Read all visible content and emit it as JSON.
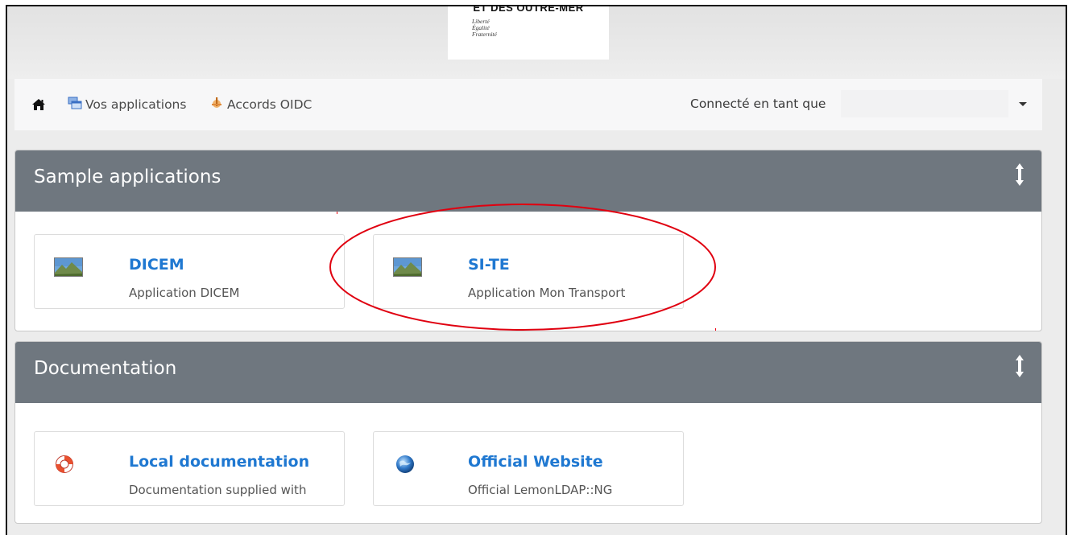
{
  "logo": {
    "title": "ET DES OUTRE-MER",
    "motto": [
      "Liberté",
      "Égalité",
      "Fraternité"
    ]
  },
  "navbar": {
    "home_icon": "home-icon",
    "apps_label": "Vos applications",
    "oidc_label": "Accords OIDC",
    "connected_label": "Connecté en tant que",
    "user_value": ""
  },
  "panels": [
    {
      "title": "Sample applications",
      "apps": [
        {
          "title": "DICEM",
          "description": "Application DICEM",
          "icon": "landscape-image-icon"
        },
        {
          "title": "SI-TE",
          "description": "Application Mon Transport",
          "icon": "landscape-image-icon"
        }
      ]
    },
    {
      "title": "Documentation",
      "apps": [
        {
          "title": "Local documentation",
          "description": "Documentation supplied with",
          "icon": "lifebuoy-icon"
        },
        {
          "title": "Official Website",
          "description": "Official LemonLDAP::NG",
          "icon": "globe-icon"
        }
      ]
    }
  ],
  "colors": {
    "panel_header": "#6f777f",
    "link": "#1f78d1",
    "annotation": "#e00010"
  }
}
